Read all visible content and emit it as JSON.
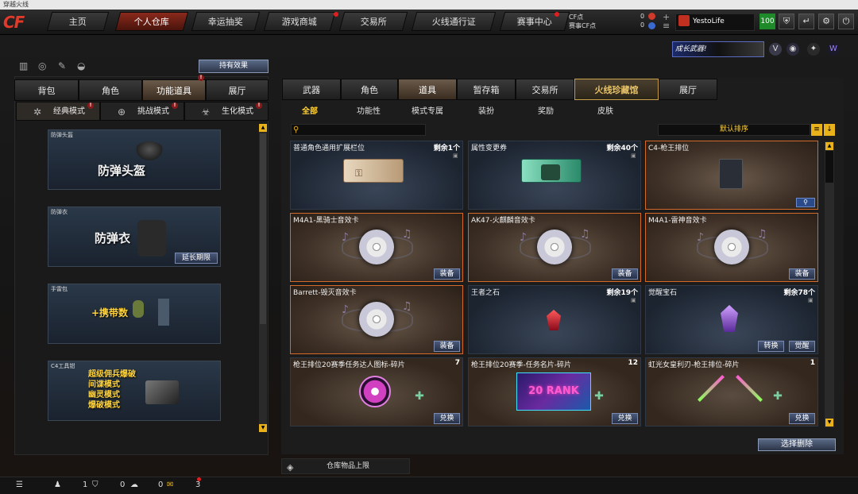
{
  "window_title": "穿越火线",
  "logo": "CF",
  "nav": [
    {
      "label": "主页"
    },
    {
      "label": "个人仓库"
    },
    {
      "label": "幸运抽奖"
    },
    {
      "label": "游戏商城"
    },
    {
      "label": "交易所"
    },
    {
      "label": "火线通行证"
    },
    {
      "label": "赛事中心"
    }
  ],
  "currency": {
    "cf_label": "CF点",
    "cf_value": "0",
    "event_label": "赛事CF点",
    "event_value": "0"
  },
  "user": {
    "name": "YestoLife",
    "level": "100"
  },
  "promo": {
    "text": "成长武器!"
  },
  "left": {
    "effect_button": "持有效果",
    "tabs": [
      {
        "label": "背包"
      },
      {
        "label": "角色"
      },
      {
        "label": "功能道具"
      },
      {
        "label": "展厅"
      }
    ],
    "modes": [
      {
        "label": "经典模式"
      },
      {
        "label": "挑战模式"
      },
      {
        "label": "生化模式"
      }
    ],
    "cards": [
      {
        "title": "防弹头盔",
        "big": "防弹头盔",
        "button": ""
      },
      {
        "title": "防弹衣",
        "big": "防弹衣",
        "button": "延长期限"
      },
      {
        "title": "手雷包",
        "big": "+携带数",
        "button": ""
      },
      {
        "title": "C4工具钳",
        "lines": [
          "超级佣兵爆破",
          "间谍模式",
          "幽灵模式",
          "爆破模式"
        ],
        "button": ""
      }
    ]
  },
  "right": {
    "tabs": [
      {
        "label": "武器"
      },
      {
        "label": "角色"
      },
      {
        "label": "道具"
      },
      {
        "label": "暂存箱"
      },
      {
        "label": "交易所"
      },
      {
        "label": "火线珍藏馆"
      },
      {
        "label": "展厅"
      }
    ],
    "subtabs": [
      {
        "label": "全部"
      },
      {
        "label": "功能性"
      },
      {
        "label": "模式专属"
      },
      {
        "label": "装扮"
      },
      {
        "label": "奖励"
      },
      {
        "label": "皮肤"
      }
    ],
    "sort_label": "默认排序",
    "items": [
      {
        "name": "普通角色通用扩展栏位",
        "count": "剩余1个",
        "btn1": "",
        "btn2": ""
      },
      {
        "name": "属性变更券",
        "count": "剩余40个",
        "btn1": "",
        "btn2": ""
      },
      {
        "name": "C4-枪王排位",
        "count": "",
        "btn1": "",
        "btn2": ""
      },
      {
        "name": "M4A1-黑骑士音效卡",
        "count": "",
        "btn1": "装备",
        "btn2": ""
      },
      {
        "name": "AK47-火麒麟音效卡",
        "count": "",
        "btn1": "装备",
        "btn2": ""
      },
      {
        "name": "M4A1-雷神音效卡",
        "count": "",
        "btn1": "装备",
        "btn2": ""
      },
      {
        "name": "Barrett-毁灭音效卡",
        "count": "",
        "btn1": "装备",
        "btn2": ""
      },
      {
        "name": "王者之石",
        "count": "剩余19个",
        "btn1": "",
        "btn2": ""
      },
      {
        "name": "觉醒宝石",
        "count": "剩余78个",
        "btn1": "转换",
        "btn2": "觉醒"
      },
      {
        "name": "枪王排位20赛季任务达人图标-碎片",
        "count": "7",
        "btn1": "兑换",
        "btn2": ""
      },
      {
        "name": "枪王排位20赛季-任务名片-碎片",
        "count": "12",
        "btn1": "兑换",
        "btn2": ""
      },
      {
        "name": "虹光女皇利刃-枪王排位-碎片",
        "count": "1",
        "btn1": "兑换",
        "btn2": ""
      }
    ],
    "rank_text": "20 RANK",
    "delete_button": "选择删除",
    "capacity_button": "仓库物品上限"
  },
  "statusbar": {
    "players": "1",
    "shield": "0",
    "chat": "0",
    "gift": "3"
  }
}
